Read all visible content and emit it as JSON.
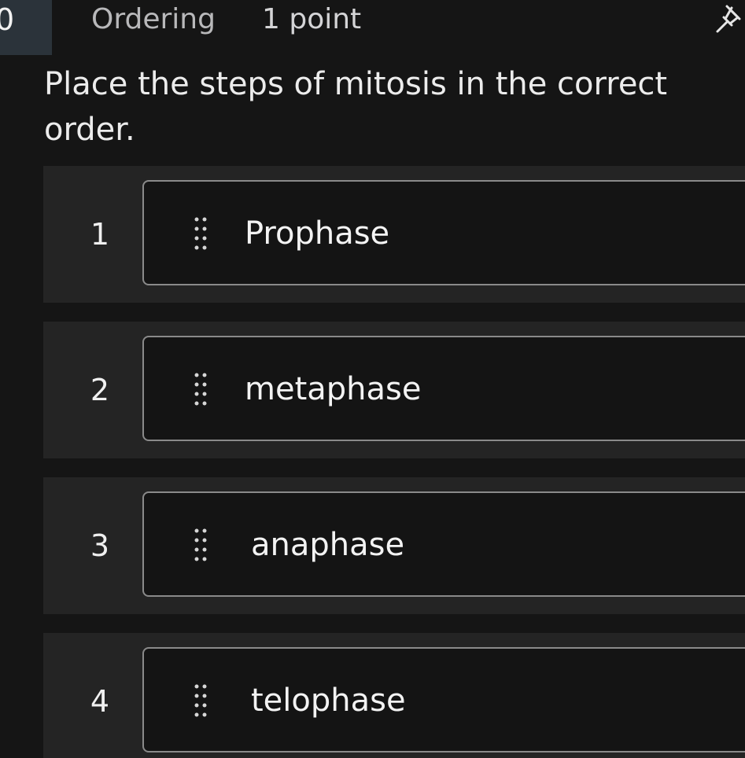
{
  "question": {
    "number": "0",
    "type": "Ordering",
    "points": "1 point",
    "prompt": "Place the steps of mitosis in the correct order."
  },
  "ordering": {
    "items": [
      {
        "position": "1",
        "label": "Prophase"
      },
      {
        "position": "2",
        "label": "metaphase"
      },
      {
        "position": "3",
        "label": "anaphase"
      },
      {
        "position": "4",
        "label": "telophase"
      }
    ]
  },
  "icons": {
    "pin": "pin-icon",
    "drag": "drag-handle-icon"
  },
  "colors": {
    "background": "#151515",
    "row_background": "#242424",
    "card_border": "#8a8a8a",
    "question_number_box": "#2b333a"
  }
}
